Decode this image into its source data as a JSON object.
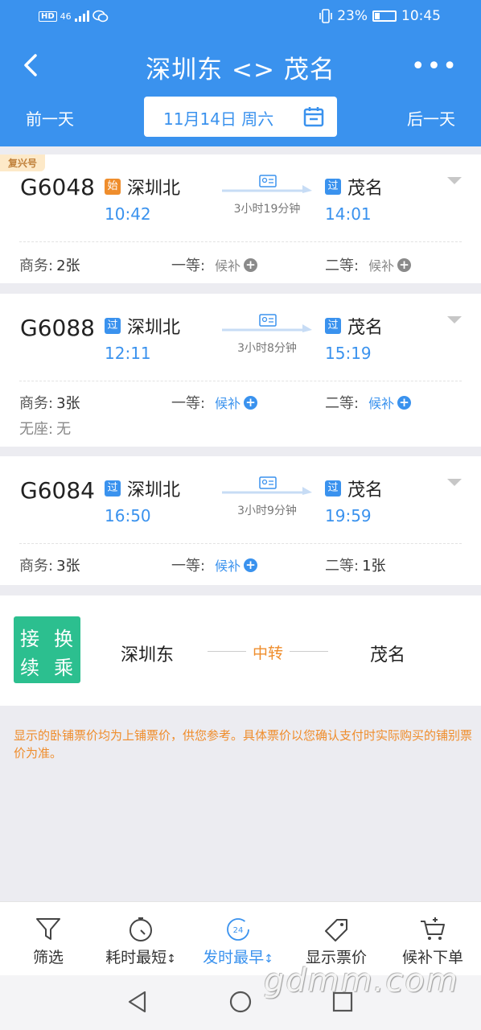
{
  "status_bar": {
    "left_badges": [
      "HD",
      "46"
    ],
    "battery": "23%",
    "time": "10:45"
  },
  "header": {
    "title": "深圳东 <> 茂名",
    "more": "•••"
  },
  "date_bar": {
    "prev": "前一天",
    "date": "11月14日 周六",
    "next": "后一天"
  },
  "trains": [
    {
      "badge": "复兴号",
      "number": "G6048",
      "from_tag": "始",
      "from": "深圳北",
      "depart": "10:42",
      "duration": "3小时19分钟",
      "to_tag": "过",
      "to": "茂名",
      "arrive": "14:01",
      "seats": [
        {
          "label": "商务:",
          "value": "2张"
        },
        {
          "label": "一等:",
          "value": "候补"
        },
        {
          "label": "二等:",
          "value": "候补"
        }
      ]
    },
    {
      "number": "G6088",
      "from_tag": "过",
      "from": "深圳北",
      "depart": "12:11",
      "duration": "3小时8分钟",
      "to_tag": "过",
      "to": "茂名",
      "arrive": "15:19",
      "seats": [
        {
          "label": "商务:",
          "value": "3张"
        },
        {
          "label": "一等:",
          "value": "候补"
        },
        {
          "label": "二等:",
          "value": "候补"
        },
        {
          "label": "无座:",
          "value": "无"
        }
      ]
    },
    {
      "number": "G6084",
      "from_tag": "过",
      "from": "深圳北",
      "depart": "16:50",
      "duration": "3小时9分钟",
      "to_tag": "过",
      "to": "茂名",
      "arrive": "19:59",
      "seats": [
        {
          "label": "商务:",
          "value": "3张"
        },
        {
          "label": "一等:",
          "value": "候补"
        },
        {
          "label": "二等:",
          "value": "1张"
        }
      ]
    }
  ],
  "transfer": {
    "icon_chars": [
      "接",
      "换",
      "续",
      "乘"
    ],
    "from": "深圳东",
    "mid": "中转",
    "to": "茂名"
  },
  "notice": "显示的卧铺票价均为上铺票价，供您参考。具体票价以您确认支付时实际购买的铺别票价为准。",
  "toolbar": {
    "filter": "筛选",
    "shortest": "耗时最短",
    "earliest": "发时最早",
    "earliest_badge": "24",
    "show_price": "显示票价",
    "waitlist": "候补下单"
  },
  "watermark": "gdmm.com",
  "colors": {
    "primary": "#3a92ee",
    "orange": "#ef8d2c",
    "green": "#2cbf8f"
  }
}
